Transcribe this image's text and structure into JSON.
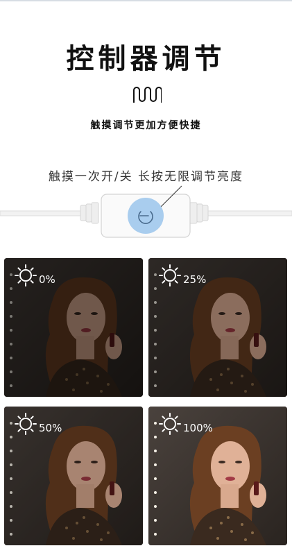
{
  "header": {
    "title": "控制器调节",
    "subtitle": "触摸调节更加方便快捷"
  },
  "controller": {
    "caption": "触摸一次开/关 长按无限调节亮度",
    "button_icon": "power-icon",
    "accent": "#a9cdee"
  },
  "tiles": [
    {
      "label": "0%",
      "level": 0.0
    },
    {
      "label": "25%",
      "level": 0.25
    },
    {
      "label": "50%",
      "level": 0.5
    },
    {
      "label": "100%",
      "level": 1.0
    }
  ]
}
